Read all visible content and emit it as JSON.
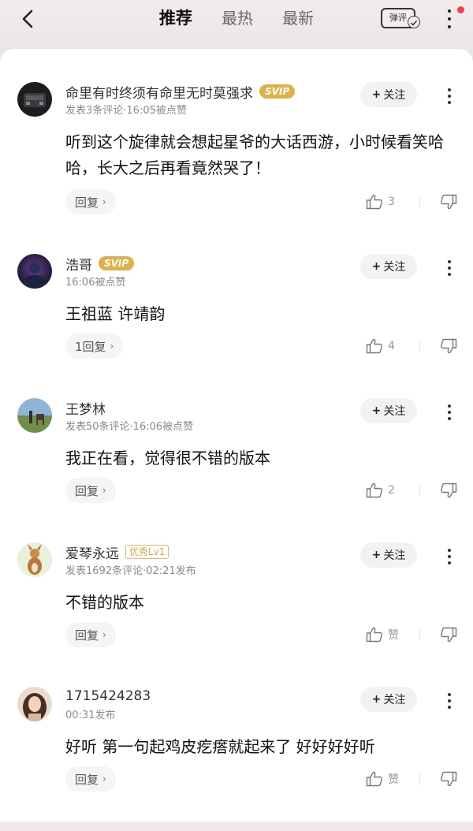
{
  "header": {
    "tabs": [
      {
        "label": "推荐",
        "active": true
      },
      {
        "label": "最热",
        "active": false
      },
      {
        "label": "最新",
        "active": false
      }
    ],
    "danmu_label": "弹评"
  },
  "colors": {
    "vip_badge": "#e0b04a",
    "notification_dot": "#f33d4f"
  },
  "comments": [
    {
      "name": "命里有时终须有命里无时莫强求",
      "badge": "SVIP",
      "meta": "发表3条评论·16:05被点赞",
      "follow_label": "关注",
      "text": "听到这个旋律就会想起星爷的大话西游，小时候看笑哈哈，长大之后再看竟然哭了！",
      "reply_label": "回复",
      "likes": "3"
    },
    {
      "name": "浩哥",
      "badge": "SVIP",
      "meta": "16:06被点赞",
      "follow_label": "关注",
      "text": "王祖蓝 许靖韵",
      "reply_label": "1回复",
      "likes": "4"
    },
    {
      "name": "王梦林",
      "badge": "",
      "meta": "发表50条评论·16:06被点赞",
      "follow_label": "关注",
      "text": "我正在看，觉得很不错的版本",
      "reply_label": "回复",
      "likes": "2"
    },
    {
      "name": "爱琴永远",
      "badge": "优秀Lv1",
      "meta": "发表1692条评论·02:21发布",
      "follow_label": "关注",
      "text": "不错的版本",
      "reply_label": "回复",
      "likes": "赞"
    },
    {
      "name": "1715424283",
      "badge": "",
      "meta": "00:31发布",
      "follow_label": "关注",
      "text": "好听 第一句起鸡皮疙瘩就起来了 好好好好听",
      "reply_label": "回复",
      "likes": "赞"
    }
  ]
}
